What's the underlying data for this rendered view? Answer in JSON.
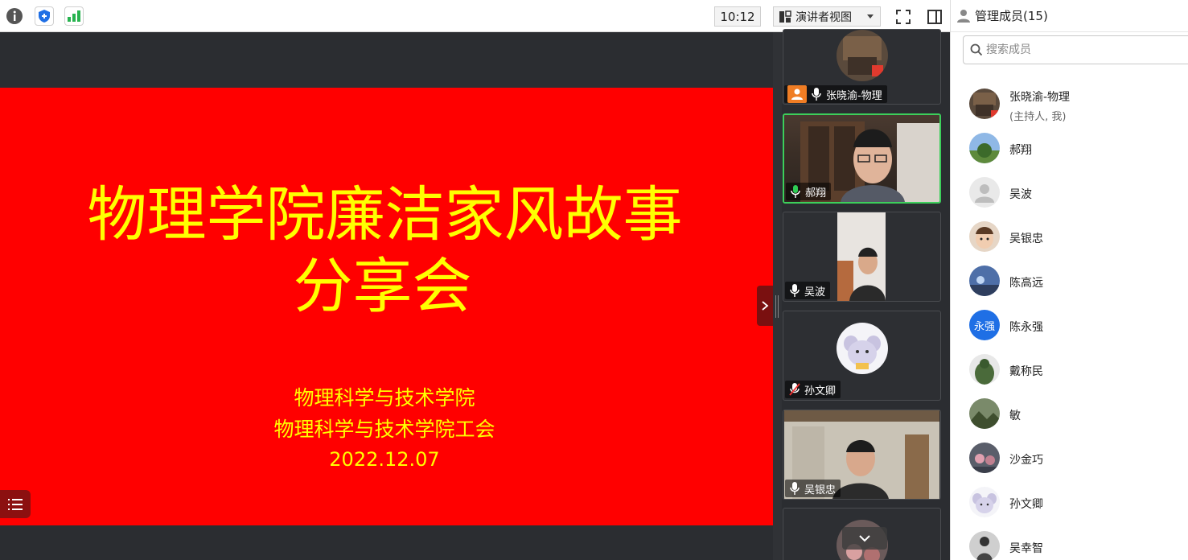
{
  "toolbar": {
    "time": "10:12",
    "view_mode": "演讲者视图"
  },
  "slide": {
    "title_line1": "物理学院廉洁家风故事",
    "title_line2": "分享会",
    "subtitle1": "物理科学与技术学院",
    "subtitle2": "物理科学与技术学院工会",
    "date": "2022.12.07",
    "bg_color": "#ff0000",
    "text_color": "#ffff00"
  },
  "video_tiles": [
    {
      "name": "张晓渝-物理",
      "host": true
    },
    {
      "name": "郝翔",
      "active": true
    },
    {
      "name": "吴波"
    },
    {
      "name": "孙文卿",
      "muted": true
    },
    {
      "name": "吴银忠"
    }
  ],
  "panel": {
    "title": "管理成员(15)",
    "search_placeholder": "搜索成员",
    "members": [
      {
        "name": "张晓渝-物理",
        "role": "(主持人, 我)"
      },
      {
        "name": "郝翔"
      },
      {
        "name": "吴波"
      },
      {
        "name": "吴银忠"
      },
      {
        "name": "陈高远"
      },
      {
        "name": "陈永强",
        "initials": "永强"
      },
      {
        "name": "戴称民"
      },
      {
        "name": "敏"
      },
      {
        "name": "沙金巧"
      },
      {
        "name": "孙文卿"
      },
      {
        "name": "吴幸智"
      }
    ]
  }
}
